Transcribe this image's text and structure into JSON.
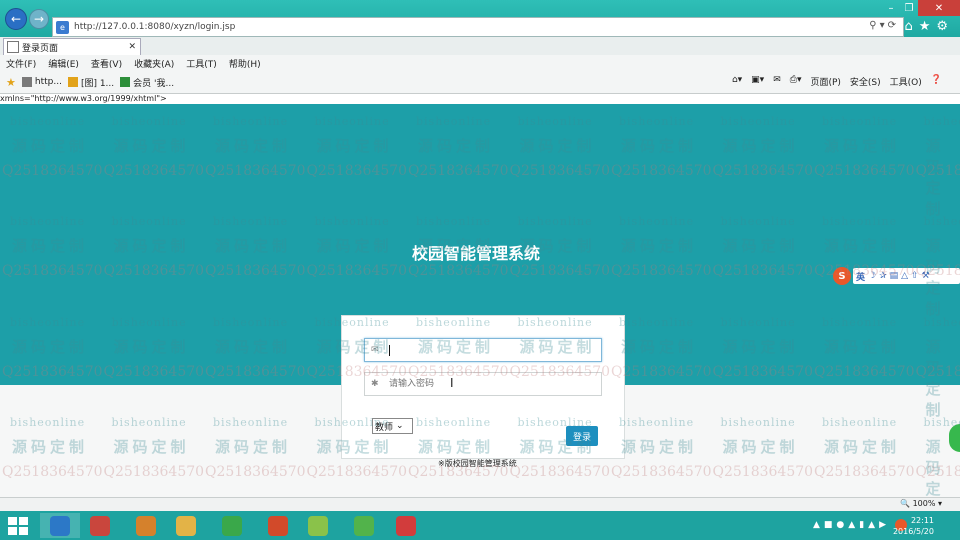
{
  "browser": {
    "url": "http://127.0.0.1:8080/xyzn/login.jsp",
    "tab_title": "登录页面",
    "menu": [
      "文件(F)",
      "编辑(E)",
      "查看(V)",
      "收藏夹(A)",
      "工具(T)",
      "帮助(H)"
    ],
    "favorites": [
      {
        "label": "http...",
        "icon": "page-icon",
        "color": "#7a7a7a"
      },
      {
        "label": "[图] 1...",
        "icon": "folder-icon",
        "color": "#e2a31a"
      },
      {
        "label": "会员 '我...",
        "icon": "app-icon",
        "color": "#2d8f3a"
      }
    ],
    "command_bar": [
      "页面(P)",
      "安全(S)",
      "工具(O)"
    ],
    "source_line": "xmlns=\"http://www.w3.org/1999/xhtml\">",
    "zoom": "100%"
  },
  "page": {
    "system_name": "校园智能管理系统",
    "username_value": "",
    "password_placeholder": "请输入密码",
    "role_selected": "教师",
    "login_label": "登录",
    "copyright": "※版校园智能管理系统"
  },
  "sougou": {
    "label": "英"
  },
  "watermark": {
    "line1": "bisheonline",
    "line2": "源码定制",
    "line3": "Q2518364570"
  },
  "taskbar": {
    "time": "22:11",
    "date": "2016/5/20",
    "apps": [
      {
        "name": "ie-app",
        "color": "#2c78c7"
      },
      {
        "name": "paint-app",
        "color": "#c9463d"
      },
      {
        "name": "book-app",
        "color": "#d5812c"
      },
      {
        "name": "explorer-app",
        "color": "#e3b347"
      },
      {
        "name": "wechat-app",
        "color": "#3aa84a"
      },
      {
        "name": "java-app",
        "color": "#d24a2a"
      },
      {
        "name": "editor-app",
        "color": "#8ac24a"
      },
      {
        "name": "browser-app",
        "color": "#52b34b"
      },
      {
        "name": "jar-app",
        "color": "#d23c3c"
      }
    ]
  },
  "colors": {
    "teal": "#1d9fa8",
    "login_button": "#1d8fbf"
  }
}
